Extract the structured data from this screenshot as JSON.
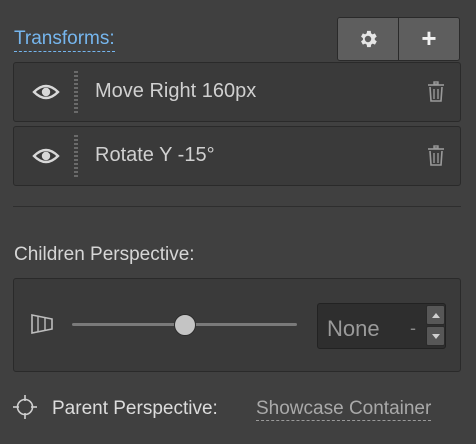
{
  "transforms": {
    "label": "Transforms:",
    "items": [
      {
        "label": "Move Right 160px"
      },
      {
        "label": "Rotate Y -15°"
      }
    ]
  },
  "children_perspective": {
    "label": "Children Perspective:",
    "slider_fraction": 0.5,
    "value": "None",
    "unit": "-"
  },
  "parent_perspective": {
    "label": "Parent Perspective:",
    "value": "Showcase Container"
  },
  "colors": {
    "background": "#404040",
    "panel": "#3a3a3a",
    "link_blue": "#76b6ee"
  },
  "icons": {
    "settings": "gear-icon",
    "add": "plus-icon",
    "visibility": "eye-icon",
    "delete": "trash-icon",
    "perspective": "perspective-icon",
    "target": "crosshair-icon"
  }
}
